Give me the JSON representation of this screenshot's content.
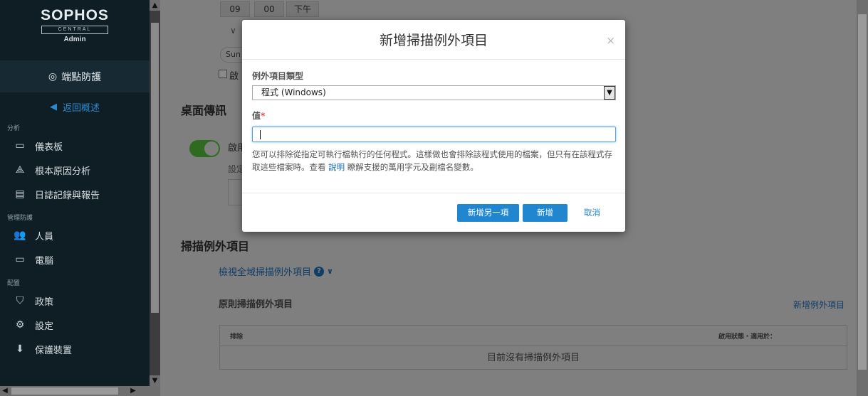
{
  "sidebar": {
    "logo_title": "SOPHOS",
    "logo_sub": "CENTRAL",
    "logo_role": "Admin",
    "product": "端點防護",
    "back": "返回概述",
    "sections": {
      "analysis": "分析",
      "manage": "管理防護",
      "config": "配置"
    },
    "items": [
      {
        "label": "儀表板",
        "icon": "dashboard-icon"
      },
      {
        "label": "根本原因分析",
        "icon": "root-cause-icon"
      },
      {
        "label": "日誌記錄與報告",
        "icon": "report-icon"
      },
      {
        "label": "人員",
        "icon": "people-icon"
      },
      {
        "label": "電腦",
        "icon": "computer-icon"
      },
      {
        "label": "政策",
        "icon": "shield-icon"
      },
      {
        "label": "設定",
        "icon": "gear-icon"
      },
      {
        "label": "保護裝置",
        "icon": "download-icon"
      }
    ]
  },
  "background": {
    "time_hour": "09",
    "time_min": "00",
    "time_ampm": "下午",
    "day_pill": "Sun",
    "checkbox_label": "啟",
    "desktop_heading": "桌面傳訊",
    "toggle_label": "啟用",
    "settings_label": "設定",
    "scan_heading": "掃描例外項目",
    "global_link": "檢視全域掃描例外項目",
    "policy_heading": "原則掃描例外項目",
    "add_exclusion": "新增例外項目",
    "table_headers": [
      "排除",
      "啟用狀態・適用於："
    ],
    "empty_text": "目前沒有掃描例外項目"
  },
  "modal": {
    "title": "新增掃描例外項目",
    "close": "×",
    "type_label": "例外項目類型",
    "type_value": "程式 (Windows)",
    "value_label": "值",
    "required_mark": "*",
    "value_input": "",
    "help_pre": "您可以排除從指定可執行檔執行的任何程式。這樣做也會排除該程式使用的檔案，但只有在該程式存取這些檔案時。查看 ",
    "help_link": "說明",
    "help_post": " 瞭解支援的萬用字元及副檔名變數。",
    "btn_add_another": "新增另一項",
    "btn_add": "新增",
    "btn_cancel": "取消"
  }
}
